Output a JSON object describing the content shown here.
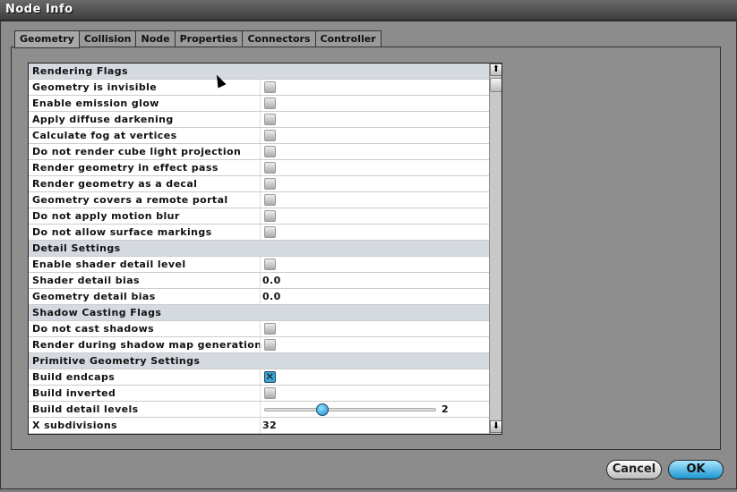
{
  "window": {
    "title": "Node Info"
  },
  "tabs": [
    "Geometry",
    "Collision",
    "Node",
    "Properties",
    "Connectors",
    "Controller"
  ],
  "rows": [
    {
      "type": "header",
      "label": "Rendering Flags"
    },
    {
      "type": "checkbox",
      "label": "Geometry is invisible",
      "checked": false
    },
    {
      "type": "checkbox",
      "label": "Enable emission glow",
      "checked": false
    },
    {
      "type": "checkbox",
      "label": "Apply diffuse darkening",
      "checked": false
    },
    {
      "type": "checkbox",
      "label": "Calculate fog at vertices",
      "checked": false
    },
    {
      "type": "checkbox",
      "label": "Do not render cube light projection",
      "checked": false
    },
    {
      "type": "checkbox",
      "label": "Render geometry in effect pass",
      "checked": false
    },
    {
      "type": "checkbox",
      "label": "Render geometry as a decal",
      "checked": false
    },
    {
      "type": "checkbox",
      "label": "Geometry covers a remote portal",
      "checked": false
    },
    {
      "type": "checkbox",
      "label": "Do not apply motion blur",
      "checked": false
    },
    {
      "type": "checkbox",
      "label": "Do not allow surface markings",
      "checked": false
    },
    {
      "type": "header",
      "label": "Detail Settings"
    },
    {
      "type": "checkbox",
      "label": "Enable shader detail level",
      "checked": false
    },
    {
      "type": "text",
      "label": "Shader detail bias",
      "value": "0.0"
    },
    {
      "type": "text",
      "label": "Geometry detail bias",
      "value": "0.0"
    },
    {
      "type": "header",
      "label": "Shadow Casting Flags"
    },
    {
      "type": "checkbox",
      "label": "Do not cast shadows",
      "checked": false
    },
    {
      "type": "checkbox",
      "label": "Render during shadow map generation",
      "checked": false
    },
    {
      "type": "header",
      "label": "Primitive Geometry Settings"
    },
    {
      "type": "checkbox",
      "label": "Build endcaps",
      "checked": true
    },
    {
      "type": "checkbox",
      "label": "Build inverted",
      "checked": false
    },
    {
      "type": "slider",
      "label": "Build detail levels",
      "value": "2",
      "fraction": 0.34
    },
    {
      "type": "text",
      "label": "X subdivisions",
      "value": "32"
    }
  ],
  "buttons": {
    "cancel": "Cancel",
    "ok": "OK"
  },
  "icons": {
    "check": "✕",
    "up": "⬆",
    "down": "⬇"
  }
}
